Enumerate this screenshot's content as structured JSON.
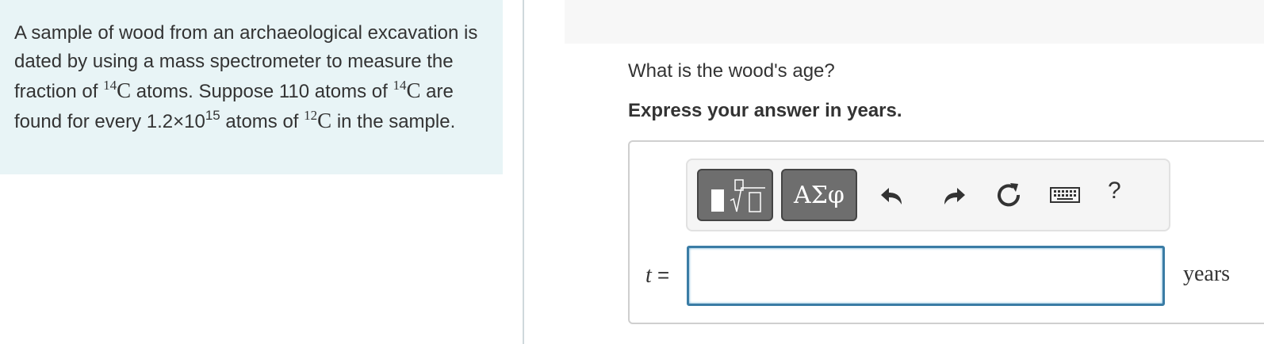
{
  "problem": {
    "text_1": "A sample of wood from an archaeological excavation is dated by using a mass spectrometer to measure the fraction of ",
    "iso1_mass": "14",
    "iso1_elem": "C",
    "text_2": " atoms. Suppose 110 atoms of ",
    "iso2_mass": "14",
    "iso2_elem": "C",
    "text_3": " are found for every 1.2×10",
    "exponent": "15",
    "text_4": " atoms of ",
    "iso3_mass": "12",
    "iso3_elem": "C",
    "text_5": " in the sample."
  },
  "question": {
    "prompt": "What is the wood's age?",
    "instruction": "Express your answer in years."
  },
  "toolbar": {
    "templates_icon": "templates-icon",
    "greek_label": "ΑΣφ",
    "undo_icon": "undo-icon",
    "redo_icon": "redo-icon",
    "reset_icon": "reset-icon",
    "keyboard_icon": "keyboard-icon",
    "help_label": "?"
  },
  "answer": {
    "variable": "t",
    "equals": "=",
    "value": "",
    "unit": "years"
  },
  "colors": {
    "panel_bg": "#e8f4f6",
    "input_border": "#3a7ca5",
    "toolbar_button": "#6e6e6e"
  }
}
